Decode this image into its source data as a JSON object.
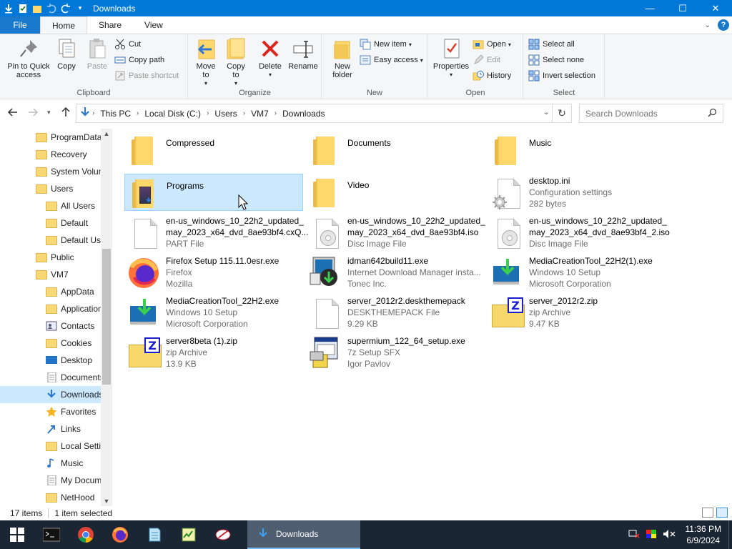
{
  "window": {
    "title": "Downloads",
    "controls": {
      "minimize": "—",
      "maximize": "☐",
      "close": "✕"
    }
  },
  "ribbon_tabs": [
    "File",
    "Home",
    "Share",
    "View"
  ],
  "ribbon": {
    "clipboard": {
      "label": "Clipboard",
      "pin": "Pin to Quick access",
      "copy": "Copy",
      "paste": "Paste",
      "cut": "Cut",
      "copy_path": "Copy path",
      "paste_shortcut": "Paste shortcut"
    },
    "organize": {
      "label": "Organize",
      "move_to": "Move to",
      "copy_to": "Copy to",
      "delete": "Delete",
      "rename": "Rename"
    },
    "new": {
      "label": "New",
      "new_folder": "New folder",
      "new_item": "New item",
      "easy_access": "Easy access"
    },
    "open": {
      "label": "Open",
      "properties": "Properties",
      "open": "Open",
      "edit": "Edit",
      "history": "History"
    },
    "select": {
      "label": "Select",
      "select_all": "Select all",
      "select_none": "Select none",
      "invert": "Invert selection"
    }
  },
  "address": {
    "crumbs": [
      "This PC",
      "Local Disk (C:)",
      "Users",
      "VM7",
      "Downloads"
    ],
    "search_placeholder": "Search Downloads"
  },
  "navpane": {
    "items": [
      {
        "label": "ProgramData",
        "indent": 1,
        "icon": "folder"
      },
      {
        "label": "Recovery",
        "indent": 1,
        "icon": "folder"
      },
      {
        "label": "System Volume Information",
        "indent": 1,
        "icon": "folder"
      },
      {
        "label": "Users",
        "indent": 1,
        "icon": "folder"
      },
      {
        "label": "All Users",
        "indent": 2,
        "icon": "folder"
      },
      {
        "label": "Default",
        "indent": 2,
        "icon": "folder"
      },
      {
        "label": "Default User",
        "indent": 2,
        "icon": "folder"
      },
      {
        "label": "Public",
        "indent": 1,
        "icon": "folder"
      },
      {
        "label": "VM7",
        "indent": 1,
        "icon": "folder"
      },
      {
        "label": "AppData",
        "indent": 2,
        "icon": "folder"
      },
      {
        "label": "Application Data",
        "indent": 2,
        "icon": "folder"
      },
      {
        "label": "Contacts",
        "indent": 2,
        "icon": "contacts"
      },
      {
        "label": "Cookies",
        "indent": 2,
        "icon": "folder"
      },
      {
        "label": "Desktop",
        "indent": 2,
        "icon": "desktop"
      },
      {
        "label": "Documents",
        "indent": 2,
        "icon": "documents"
      },
      {
        "label": "Downloads",
        "indent": 2,
        "icon": "downloads",
        "selected": true
      },
      {
        "label": "Favorites",
        "indent": 2,
        "icon": "favorites"
      },
      {
        "label": "Links",
        "indent": 2,
        "icon": "links"
      },
      {
        "label": "Local Settings",
        "indent": 2,
        "icon": "folder"
      },
      {
        "label": "Music",
        "indent": 2,
        "icon": "music"
      },
      {
        "label": "My Documents",
        "indent": 2,
        "icon": "documents"
      },
      {
        "label": "NetHood",
        "indent": 2,
        "icon": "folder"
      }
    ]
  },
  "files": [
    {
      "name": "Compressed",
      "meta": [],
      "icon": "folder"
    },
    {
      "name": "Documents",
      "meta": [],
      "icon": "folder"
    },
    {
      "name": "Music",
      "meta": [],
      "icon": "folder"
    },
    {
      "name": "Programs",
      "meta": [],
      "icon": "folder-programs",
      "selected": true
    },
    {
      "name": "Video",
      "meta": [],
      "icon": "folder"
    },
    {
      "name": "desktop.ini",
      "meta": [
        "Configuration settings",
        "282 bytes"
      ],
      "icon": "ini"
    },
    {
      "name": "en-us_windows_10_22h2_updated_",
      "name2": "may_2023_x64_dvd_8ae93bf4.cxQ...",
      "meta": [
        "PART File"
      ],
      "icon": "doc"
    },
    {
      "name": "en-us_windows_10_22h2_updated_",
      "name2": "may_2023_x64_dvd_8ae93bf4.iso",
      "meta": [
        "Disc Image File"
      ],
      "icon": "disc"
    },
    {
      "name": "en-us_windows_10_22h2_updated_",
      "name2": "may_2023_x64_dvd_8ae93bf4_2.iso",
      "meta": [
        "Disc Image File"
      ],
      "icon": "disc"
    },
    {
      "name": "Firefox Setup 115.11.0esr.exe",
      "meta": [
        "Firefox",
        "Mozilla"
      ],
      "icon": "firefox"
    },
    {
      "name": "idman642build11.exe",
      "meta": [
        "Internet Download Manager insta...",
        "Tonec Inc."
      ],
      "icon": "idm"
    },
    {
      "name": "MediaCreationTool_22H2(1).exe",
      "meta": [
        "Windows 10 Setup",
        "Microsoft Corporation"
      ],
      "icon": "mct"
    },
    {
      "name": "MediaCreationTool_22H2.exe",
      "meta": [
        "Windows 10 Setup",
        "Microsoft Corporation"
      ],
      "icon": "mct"
    },
    {
      "name": "server_2012r2.deskthemepack",
      "meta": [
        "DESKTHEMEPACK File",
        "9.29 KB"
      ],
      "icon": "doc"
    },
    {
      "name": "server_2012r2.zip",
      "meta": [
        "zip Archive",
        "9.47 KB"
      ],
      "icon": "zip"
    },
    {
      "name": "server8beta (1).zip",
      "meta": [
        "zip Archive",
        "13.9 KB"
      ],
      "icon": "zip"
    },
    {
      "name": "supermium_122_64_setup.exe",
      "meta": [
        "7z Setup SFX",
        "Igor Pavlov"
      ],
      "icon": "setup"
    }
  ],
  "status": {
    "count": "17 items",
    "selected": "1 item selected"
  },
  "taskbar": {
    "active_app": "Downloads",
    "time": "11:36 PM",
    "date": "6/9/2024"
  },
  "colors": {
    "titlebar": "#0078d7",
    "selection": "#cce8ff",
    "taskbar": "#1b2635"
  }
}
